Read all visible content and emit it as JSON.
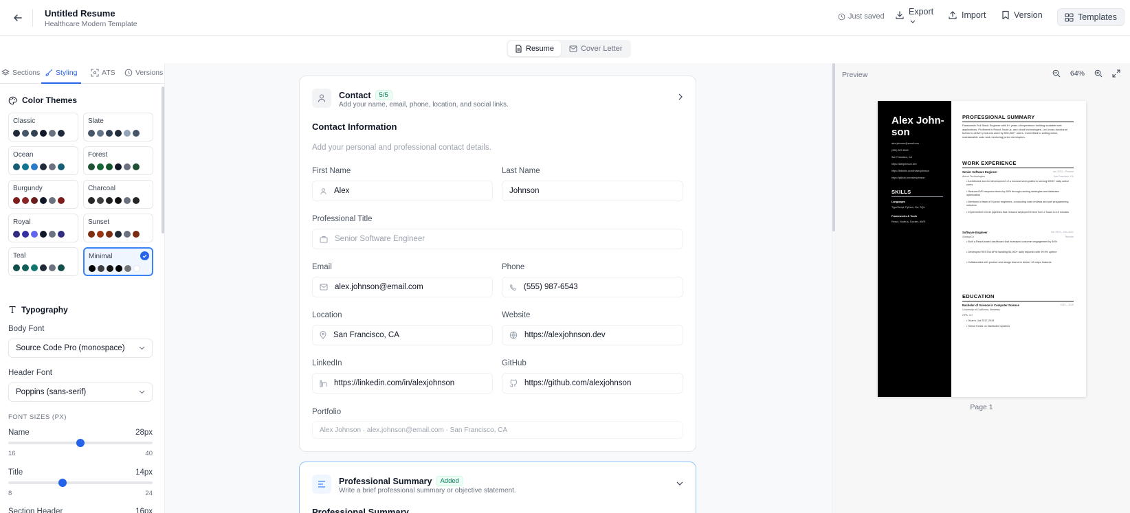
{
  "header": {
    "title": "Untitled Resume",
    "subtitle": "Healthcare Modern Template",
    "saved": "Just saved",
    "export": "Export",
    "import": "Import",
    "version": "Version",
    "templates": "Templates"
  },
  "mode": {
    "resume": "Resume",
    "cover_letter": "Cover Letter"
  },
  "sidebar": {
    "tabs": [
      "Sections",
      "Styling",
      "ATS",
      "Versions"
    ],
    "color_themes_title": "Color Themes",
    "themes": [
      {
        "name": "Classic",
        "colors": [
          "#1f2937",
          "#475569",
          "#334155",
          "#111827",
          "#6b7280",
          "#1e293b"
        ]
      },
      {
        "name": "Slate",
        "colors": [
          "#475569",
          "#64748b",
          "#334155",
          "#1f2937",
          "#94a3b8",
          "#475569"
        ]
      },
      {
        "name": "Ocean",
        "colors": [
          "#155e75",
          "#0e7490",
          "#2b7bc8",
          "#1f2937",
          "#6b7280",
          "#155e75"
        ]
      },
      {
        "name": "Forest",
        "colors": [
          "#1f5135",
          "#166534",
          "#14532d",
          "#111827",
          "#6b7280",
          "#1f5135"
        ]
      },
      {
        "name": "Burgundy",
        "colors": [
          "#7f1d1d",
          "#8b2525",
          "#6b1d1d",
          "#111827",
          "#6b7280",
          "#7f1d1d"
        ]
      },
      {
        "name": "Charcoal",
        "colors": [
          "#262626",
          "#404040",
          "#1f1f1f",
          "#111111",
          "#6b7280",
          "#262626"
        ]
      },
      {
        "name": "Royal",
        "colors": [
          "#312e81",
          "#3730a3",
          "#6366f1",
          "#111827",
          "#6b7280",
          "#312e81"
        ]
      },
      {
        "name": "Sunset",
        "colors": [
          "#7c2d12",
          "#9a3412",
          "#7c2d12",
          "#1f2937",
          "#6b7280",
          "#7c2d12"
        ]
      },
      {
        "name": "Teal",
        "colors": [
          "#134e4a",
          "#115e59",
          "#0f766e",
          "#1f2937",
          "#6b7280",
          "#134e4a"
        ]
      },
      {
        "name": "Minimal",
        "colors": [
          "#000000",
          "#404040",
          "#171717",
          "#000000",
          "#737373",
          "#ffffff"
        ]
      }
    ],
    "selected_theme": "Minimal",
    "typography_title": "Typography",
    "body_font_label": "Body Font",
    "body_font": "Source Code Pro (monospace)",
    "header_font_label": "Header Font",
    "header_font": "Poppins (sans-serif)",
    "font_sizes_title": "FONT SIZES (PX)",
    "sliders": [
      {
        "label": "Name",
        "value": "28px",
        "min": "16",
        "max": "40",
        "fraction": 0.5
      },
      {
        "label": "Title",
        "value": "14px",
        "min": "8",
        "max": "24",
        "fraction": 0.375
      },
      {
        "label": "Section Header",
        "value": "16px"
      }
    ]
  },
  "contact_card": {
    "title": "Contact",
    "badge": "5/5",
    "desc": "Add your name, email, phone, location, and social links.",
    "section_title": "Contact Information",
    "help": "Add your personal and professional contact details.",
    "first_name_label": "First Name",
    "first_name": "Alex",
    "last_name_label": "Last Name",
    "last_name": "Johnson",
    "pro_title_label": "Professional Title",
    "pro_title_placeholder": "Senior Software Engineer",
    "email_label": "Email",
    "email": "alex.johnson@email.com",
    "phone_label": "Phone",
    "phone": "(555) 987-6543",
    "location_label": "Location",
    "location": "San Francisco, CA",
    "website_label": "Website",
    "website": "https://alexjohnson.dev",
    "linkedin_label": "LinkedIn",
    "linkedin": "https://linkedin.com/in/alexjohnson",
    "github_label": "GitHub",
    "github": "https://github.com/alexjohnson",
    "portfolio_label": "Portfolio",
    "portfolio_preview": "Alex Johnson · alex.johnson@email.com · San Francisco, CA"
  },
  "summary_card": {
    "title": "Professional Summary",
    "badge": "Added",
    "desc": "Write a brief professional summary or objective statement.",
    "section_title": "Professional Summary"
  },
  "preview": {
    "label": "Preview",
    "zoom": "64%",
    "page_label": "Page 1",
    "resume": {
      "name": "Alex John-son",
      "contacts": [
        "alex.johnson@email.com",
        "(555) 987-6543",
        "San Francisco, CA",
        "https://alexjohnson.dev",
        "https://linkedin.com/in/alexjohnson",
        "https://github.com/alexjohnson"
      ],
      "skills_title": "SKILLS",
      "skill_groups": [
        {
          "name": "Languages",
          "items": "TypeScript, Python, Go, SQL"
        },
        {
          "name": "Frameworks & Tools",
          "items": "React, Node.js, Docker, AWS"
        }
      ],
      "summary_title": "PROFESSIONAL SUMMARY",
      "summary": "Passionate Full Stack Engineer with 8+ years of experience building scalable web applications. Proficient in React, Node.js, and cloud technologies. Led cross-functional teams to deliver products used by 500,000+ users. Committed to writing clean, maintainable code and mentoring junior developers.",
      "work_title": "WORK EXPERIENCE",
      "jobs": [
        {
          "role": "Senior Software Engineer",
          "dates": "Jan 2022 – Present",
          "company": "Acme Technologies",
          "location": "San Francisco, CA",
          "bullets": [
            "• Architected and led development of a microservices platform serving 500K+ daily active users",
            "• Reduced API response times by 60% through caching strategies and database optimization",
            "• Mentored a team of 5 junior engineers, conducting code reviews and pair programming sessions",
            "• Implemented CI/CD pipelines that reduced deployment time from 2 hours to 15 minutes"
          ]
        },
        {
          "role": "Software Engineer",
          "dates": "Jun 2019 – Dec 2021",
          "company": "StartupCo",
          "location": "Remote",
          "bullets": [
            "• Built a React-based dashboard that increased customer engagement by 40%",
            "• Developed RESTful APIs handling 50,000+ daily requests with 99.9% uptime",
            "• Collaborated with product and design teams to deliver 12 major features"
          ]
        }
      ],
      "education_title": "EDUCATION",
      "degree": "Bachelor of Science in Computer Science",
      "edu_dates": "2015 – 2019",
      "school": "University of California, Berkeley",
      "gpa": "GPA: 3.7",
      "edu_bullets": [
        "• Dean's List 2017-2019",
        "• Senior thesis on distributed systems"
      ]
    }
  }
}
